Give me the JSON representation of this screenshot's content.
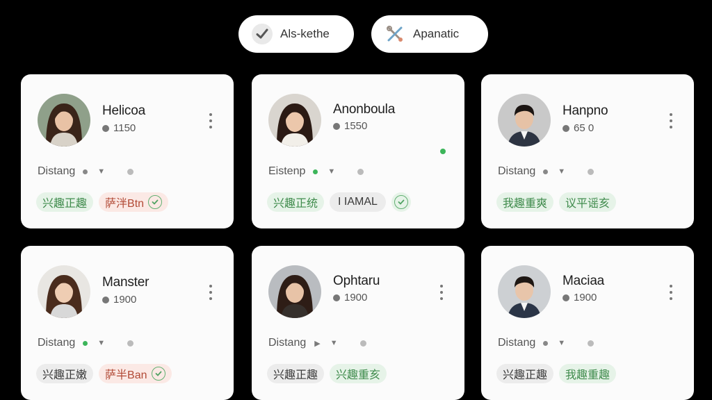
{
  "toolbar": {
    "pill_a": {
      "label": "Als-kethe",
      "icon": "check-icon"
    },
    "pill_b": {
      "label": "Apanatic",
      "icon": "wrench-cross-icon"
    }
  },
  "colors": {
    "background": "#000000",
    "card": "#fbfbfb",
    "tag_green_bg": "#e6f3e8",
    "tag_green_text": "#3f8b4c",
    "tag_red_bg": "#fbe9e5",
    "tag_red_text": "#b24a36",
    "tag_gray_bg": "#ececec",
    "online": "#3cb55a"
  },
  "cards": [
    {
      "name": "Helicoa",
      "stat": "1150",
      "distance_label": "Distang",
      "tags": [
        {
          "text": "兴趣正趣",
          "style": "green"
        },
        {
          "text": "萨泮Btn",
          "style": "red",
          "check": true
        }
      ]
    },
    {
      "name": "Anonboula",
      "stat": "1550",
      "distance_label": "Eistenp",
      "online": true,
      "tags": [
        {
          "text": "兴趣正统",
          "style": "green"
        },
        {
          "text": "I IAMAL",
          "style": "gray"
        }
      ],
      "solo_check": true
    },
    {
      "name": "Hanpno",
      "stat": "65 0",
      "distance_label": "Distang",
      "tags": [
        {
          "text": "我趣重爽",
          "style": "green"
        },
        {
          "text": "议平谣亥",
          "style": "green"
        }
      ]
    },
    {
      "name": "Manster",
      "stat": "1900",
      "distance_label": "Distang",
      "tags": [
        {
          "text": "兴趣正嫩",
          "style": "gray"
        },
        {
          "text": "萨半Ban",
          "style": "red",
          "check": true
        }
      ]
    },
    {
      "name": "Ophtaru",
      "stat": "1900",
      "distance_label": "Distang",
      "tags": [
        {
          "text": "兴趣正趣",
          "style": "gray"
        },
        {
          "text": "兴趣重亥",
          "style": "green"
        }
      ]
    },
    {
      "name": "Maciaa",
      "stat": "1900",
      "distance_label": "Distang",
      "tags": [
        {
          "text": "兴趣正趣",
          "style": "gray"
        },
        {
          "text": "我趣重趣",
          "style": "green"
        }
      ]
    }
  ]
}
